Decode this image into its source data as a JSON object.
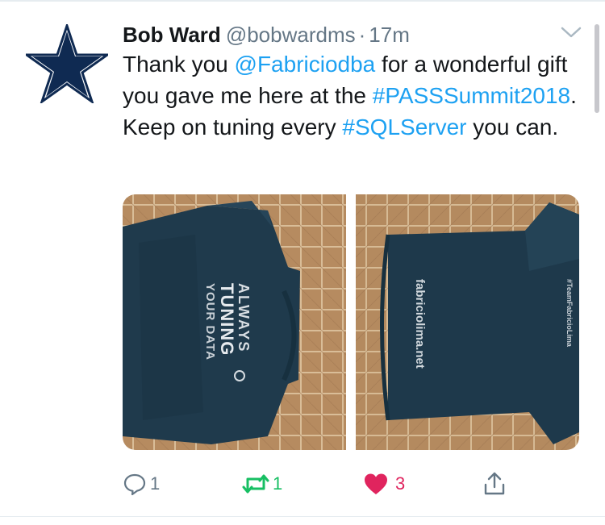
{
  "tweet": {
    "author_name": "Bob Ward",
    "handle": "@bobwardms",
    "separator": "·",
    "time": "17m",
    "text": {
      "p1": "Thank you ",
      "mention": "@Fabriciodba",
      "p2": " for a wonderful gift you gave me here at the ",
      "hashtag1": "#PASSSummit2018",
      "p3": ". Keep on tuning every ",
      "hashtag2": "#SQLServer",
      "p4": " you can."
    },
    "media": {
      "left_shirt_print": [
        "ALWAYS",
        "TUNING",
        "YOUR DATA"
      ],
      "right_shirt_print": [
        "fabriciolima.net"
      ],
      "right_sleeve_print": "#TeamFabricioLima"
    },
    "actions": {
      "reply_count": "1",
      "retweet_count": "1",
      "like_count": "3"
    }
  },
  "colors": {
    "link": "#1da1f2",
    "retweet": "#17bf63",
    "like": "#e0245e",
    "muted": "#657786",
    "shirt": "#1f3a4c",
    "floor": "#b88d62"
  },
  "icons": {
    "avatar": "star-icon",
    "caret": "chevron-down-icon",
    "reply": "reply-icon",
    "retweet": "retweet-icon",
    "like": "heart-icon",
    "share": "share-icon"
  }
}
